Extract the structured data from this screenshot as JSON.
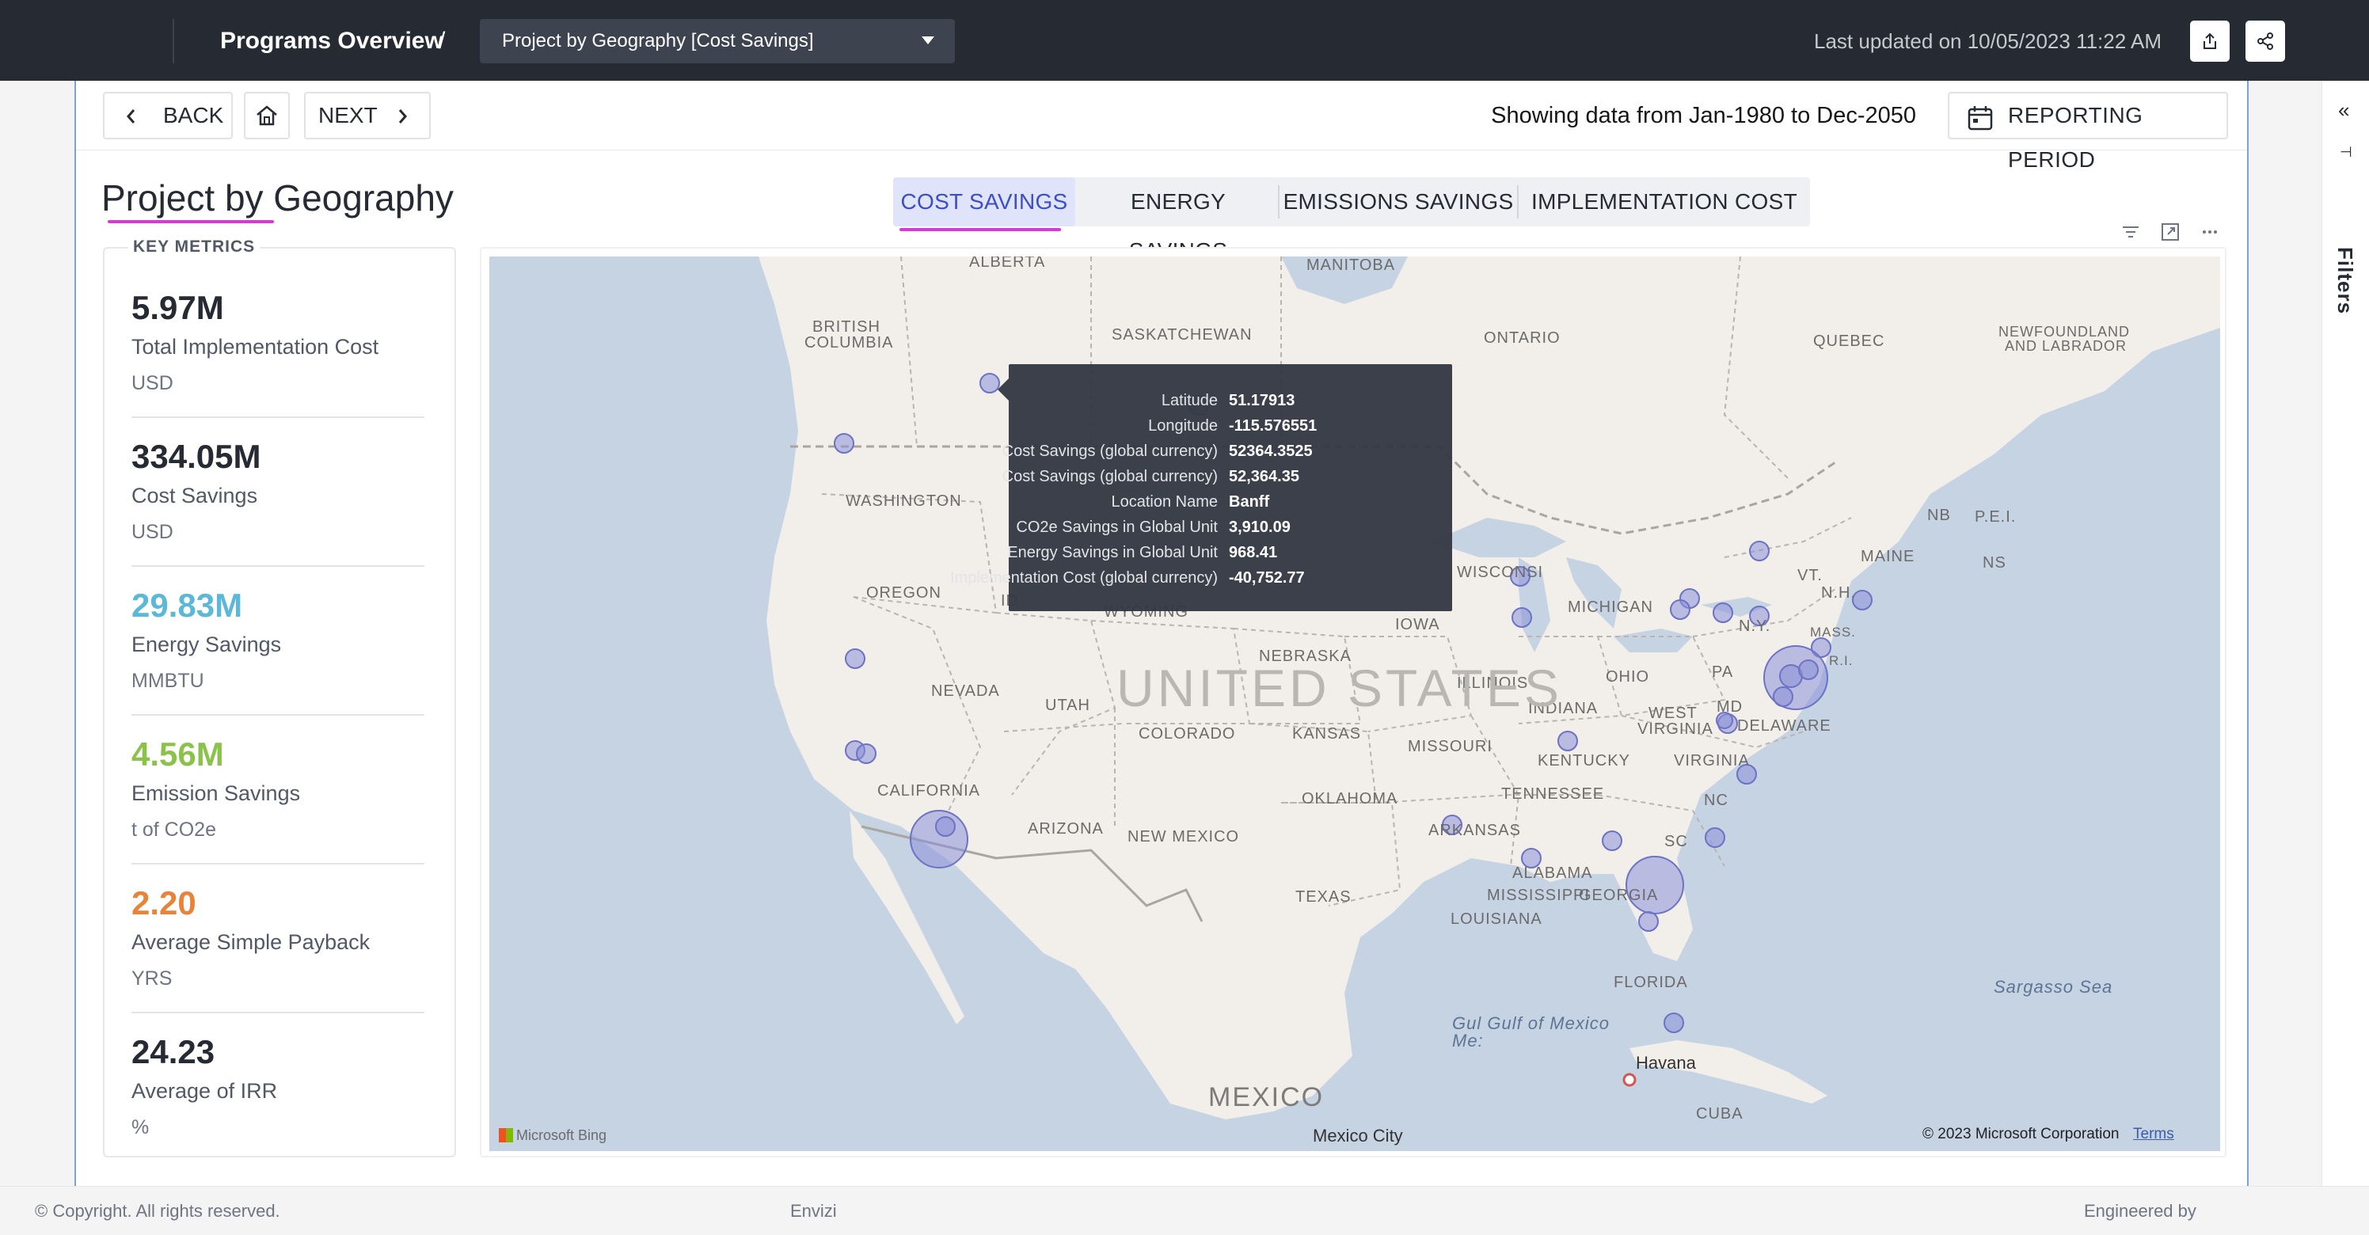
{
  "header": {
    "breadcrumb": "Programs Overview",
    "separator": "/",
    "report_select": "Project by Geography [Cost Savings]",
    "last_updated": "Last updated on 10/05/2023 11:22 AM",
    "icons": [
      "export-icon",
      "share-icon"
    ]
  },
  "nav": {
    "back_label": "BACK",
    "next_label": "NEXT",
    "showing_text": "Showing data from Jan-1980 to Dec-2050",
    "reporting_period_label": "REPORTING PERIOD"
  },
  "page": {
    "title": "Project by Geography",
    "tabs": [
      {
        "label": "COST SAVINGS",
        "active": true
      },
      {
        "label": "ENERGY SAVINGS",
        "active": false
      },
      {
        "label": "EMISSIONS SAVINGS",
        "active": false
      },
      {
        "label": "IMPLEMENTATION COST",
        "active": false
      }
    ]
  },
  "key_metrics": {
    "title": "KEY METRICS",
    "items": [
      {
        "value": "5.97M",
        "label": "Total Implementation Cost",
        "unit": "USD",
        "color": "#262a33"
      },
      {
        "value": "334.05M",
        "label": "Cost Savings",
        "unit": "USD",
        "color": "#262a33"
      },
      {
        "value": "29.83M",
        "label": "Energy Savings",
        "unit": "MMBTU",
        "color": "#5bb8d8"
      },
      {
        "value": "4.56M",
        "label": "Emission Savings",
        "unit": "t of CO2e",
        "color": "#8bc34a"
      },
      {
        "value": "2.20",
        "label": "Average Simple Payback",
        "unit": "YRS",
        "color": "#e8833a"
      },
      {
        "value": "24.23",
        "label": "Average of IRR",
        "unit": "%",
        "color": "#262a33"
      }
    ]
  },
  "map": {
    "labels": {
      "alberta": "ALBERTA",
      "manitoba": "MANITOBA",
      "british_columbia_1": "BRITISH",
      "british_columbia_2": "COLUMBIA",
      "saskatchewan": "SASKATCHEWAN",
      "ontario": "ONTARIO",
      "quebec": "QUEBEC",
      "newfoundland_1": "NEWFOUNDLAND",
      "newfoundland_2": "AND LABRADOR",
      "washington": "WASHINGTON",
      "oregon": "OREGON",
      "idaho": "ID",
      "wyoming": "WYOMING",
      "nevada": "NEVADA",
      "utah": "UTAH",
      "california": "CALIFORNIA",
      "arizona": "ARIZONA",
      "colorado": "COLORADO",
      "new_mexico": "NEW MEXICO",
      "nebraska": "NEBRASKA",
      "kansas": "KANSAS",
      "oklahoma": "OKLAHOMA",
      "texas": "TEXAS",
      "iowa": "IOWA",
      "missouri": "MISSOURI",
      "arkansas": "ARKANSAS",
      "louisiana": "LOUISIANA",
      "mississippi": "MISSISSIPPI",
      "illinois": "ILLINOIS",
      "wisconsin": "WISCONSI",
      "michigan": "MICHIGAN",
      "indiana": "INDIANA",
      "ohio": "OHIO",
      "kentucky": "KENTUCKY",
      "tennessee": "TENNESSEE",
      "alabama": "ALABAMA",
      "georgia": "GEORGIA",
      "florida": "FLORIDA",
      "west_virginia_1": "WEST",
      "west_virginia_2": "VIRGINIA",
      "virginia": "VIRGINIA",
      "pa": "PA",
      "md": "MD",
      "delaware": "DELAWARE",
      "nc": "NC",
      "sc": "SC",
      "ny": "N.Y.",
      "vt": "VT.",
      "nh": "N.H.",
      "mass": "MASS.",
      "ri": "R.I.",
      "maine": "MAINE",
      "nb": "NB",
      "pei": "P.E.I.",
      "ns": "NS",
      "united_states": "UNITED STATES",
      "mexico": "MEXICO",
      "mexico_city": "Mexico City",
      "havana": "Havana",
      "cuba": "CUBA",
      "gulf": "Gul Gulf of Mexico",
      "gulf_2": "Me:",
      "sargasso": "Sargasso Sea"
    },
    "bing_label": "Microsoft Bing",
    "copyright": "© 2023 Microsoft Corporation",
    "terms": "Terms"
  },
  "tooltip": [
    {
      "key": "Latitude",
      "value": "51.17913"
    },
    {
      "key": "Longitude",
      "value": "-115.576551"
    },
    {
      "key": "Cost Savings (global currency)",
      "value": "52364.3525"
    },
    {
      "key": "Cost Savings (global currency)",
      "value": "52,364.35"
    },
    {
      "key": "Location Name",
      "value": "Banff"
    },
    {
      "key": "CO2e Savings in Global Unit",
      "value": "3,910.09"
    },
    {
      "key": "Energy Savings in Global Unit",
      "value": "968.41"
    },
    {
      "key": "Implementation Cost (global currency)",
      "value": "-40,752.77"
    }
  ],
  "rail": {
    "filters_label": "Filters"
  },
  "footer": {
    "copyright": "© Copyright. All rights reserved.",
    "brand": "Envizi",
    "engineered_by": "Engineered by"
  }
}
